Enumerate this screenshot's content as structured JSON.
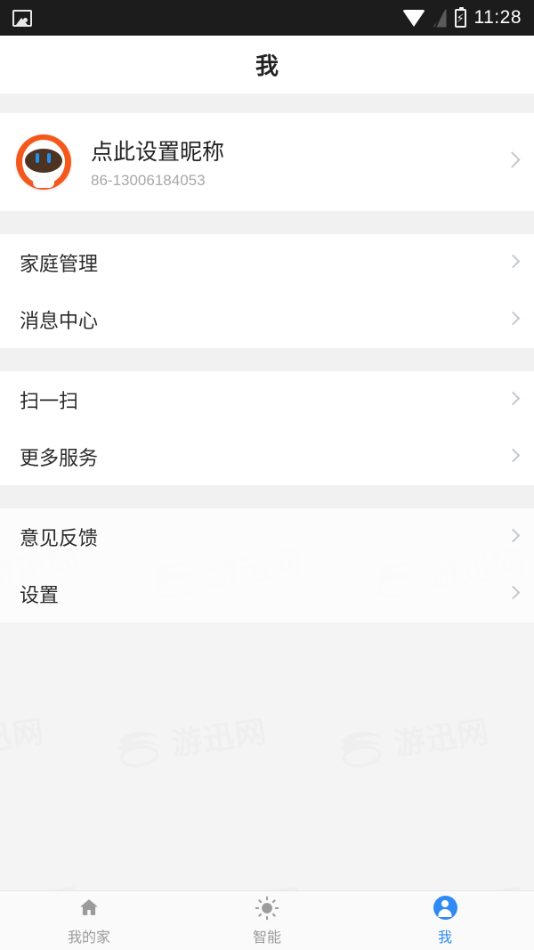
{
  "statusbar": {
    "time": "11:28",
    "icons": [
      "image-icon",
      "wifi-icon",
      "signal-off-icon",
      "battery-charging-icon"
    ]
  },
  "header": {
    "title": "我"
  },
  "profile": {
    "name": "点此设置昵称",
    "phone": "86-13006184053",
    "avatar_alt": "robot-avatar",
    "avatar_colors": {
      "ring": "#f4581c",
      "face": "#4d3322",
      "eye": "#1f93f0"
    }
  },
  "menu_groups": [
    {
      "items": [
        {
          "label": "家庭管理",
          "name": "family-management"
        },
        {
          "label": "消息中心",
          "name": "message-center"
        }
      ]
    },
    {
      "items": [
        {
          "label": "扫一扫",
          "name": "scan"
        },
        {
          "label": "更多服务",
          "name": "more-services"
        }
      ]
    },
    {
      "items": [
        {
          "label": "意见反馈",
          "name": "feedback"
        },
        {
          "label": "设置",
          "name": "settings"
        }
      ]
    }
  ],
  "watermark": {
    "text": "游迅网"
  },
  "tabbar": {
    "active_color": "#2f8bf2",
    "inactive_color": "#9b9b9b",
    "tabs": [
      {
        "label": "我的家",
        "icon": "home-icon",
        "active": false
      },
      {
        "label": "智能",
        "icon": "brightness-icon",
        "active": false
      },
      {
        "label": "我",
        "icon": "person-icon",
        "active": true
      }
    ]
  }
}
